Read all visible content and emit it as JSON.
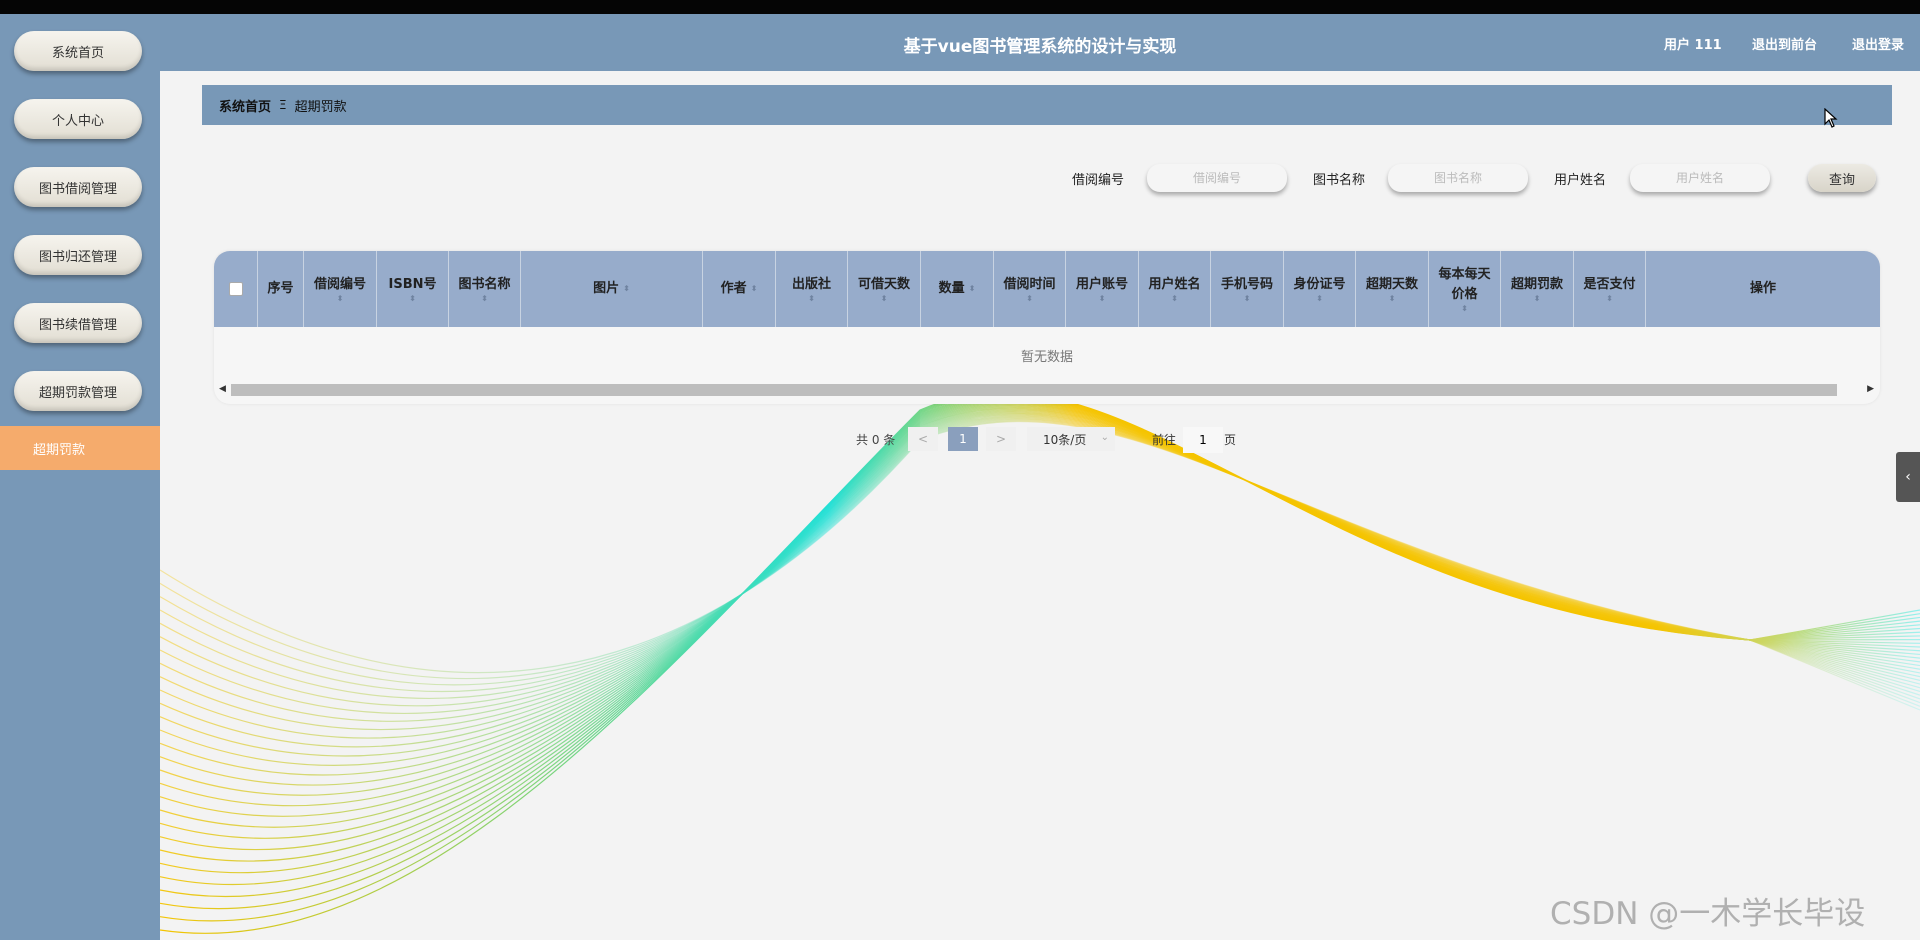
{
  "header": {
    "title": "基于vue图书管理系统的设计与实现",
    "user": "用户 111",
    "back_front": "退出到前台",
    "logout": "退出登录"
  },
  "sidebar": {
    "items": [
      {
        "label": "系统首页"
      },
      {
        "label": "个人中心"
      },
      {
        "label": "图书借阅管理"
      },
      {
        "label": "图书归还管理"
      },
      {
        "label": "图书续借管理"
      },
      {
        "label": "超期罚款管理"
      }
    ],
    "active_sub": "超期罚款"
  },
  "breadcrumb": {
    "home": "系统首页",
    "separator": "Ξ",
    "current": "超期罚款"
  },
  "search": {
    "fields": [
      {
        "label": "借阅编号",
        "placeholder": "借阅编号"
      },
      {
        "label": "图书名称",
        "placeholder": "图书名称"
      },
      {
        "label": "用户姓名",
        "placeholder": "用户姓名"
      }
    ],
    "query_label": "查询"
  },
  "table": {
    "columns": [
      {
        "label": "序号"
      },
      {
        "label": "借阅编号"
      },
      {
        "label": "ISBN号"
      },
      {
        "label": "图书名称"
      },
      {
        "label": "图片"
      },
      {
        "label": "作者"
      },
      {
        "label": "出版社"
      },
      {
        "label": "可借天数"
      },
      {
        "label": "数量"
      },
      {
        "label": "借阅时间"
      },
      {
        "label": "用户账号"
      },
      {
        "label": "用户姓名"
      },
      {
        "label": "手机号码"
      },
      {
        "label": "身份证号"
      },
      {
        "label": "超期天数"
      },
      {
        "label": "每本每天价格"
      },
      {
        "label": "超期罚款"
      },
      {
        "label": "是否支付"
      },
      {
        "label": "操作"
      }
    ],
    "empty_text": "暂无数据"
  },
  "pagination": {
    "total_text": "共 0 条",
    "prev": "<",
    "current_page": "1",
    "next": ">",
    "page_size": "10条/页",
    "goto_label": "前往",
    "goto_value": "1",
    "goto_unit": "页"
  },
  "watermark": "CSDN @一木学长毕设",
  "colors": {
    "sidebar": "#7898b7",
    "header": "#7898b7",
    "active_sub": "#f5ab6c",
    "table_header": "#97accb",
    "wave_cyan": "#22e0d6",
    "wave_yellow": "#f5c400"
  }
}
